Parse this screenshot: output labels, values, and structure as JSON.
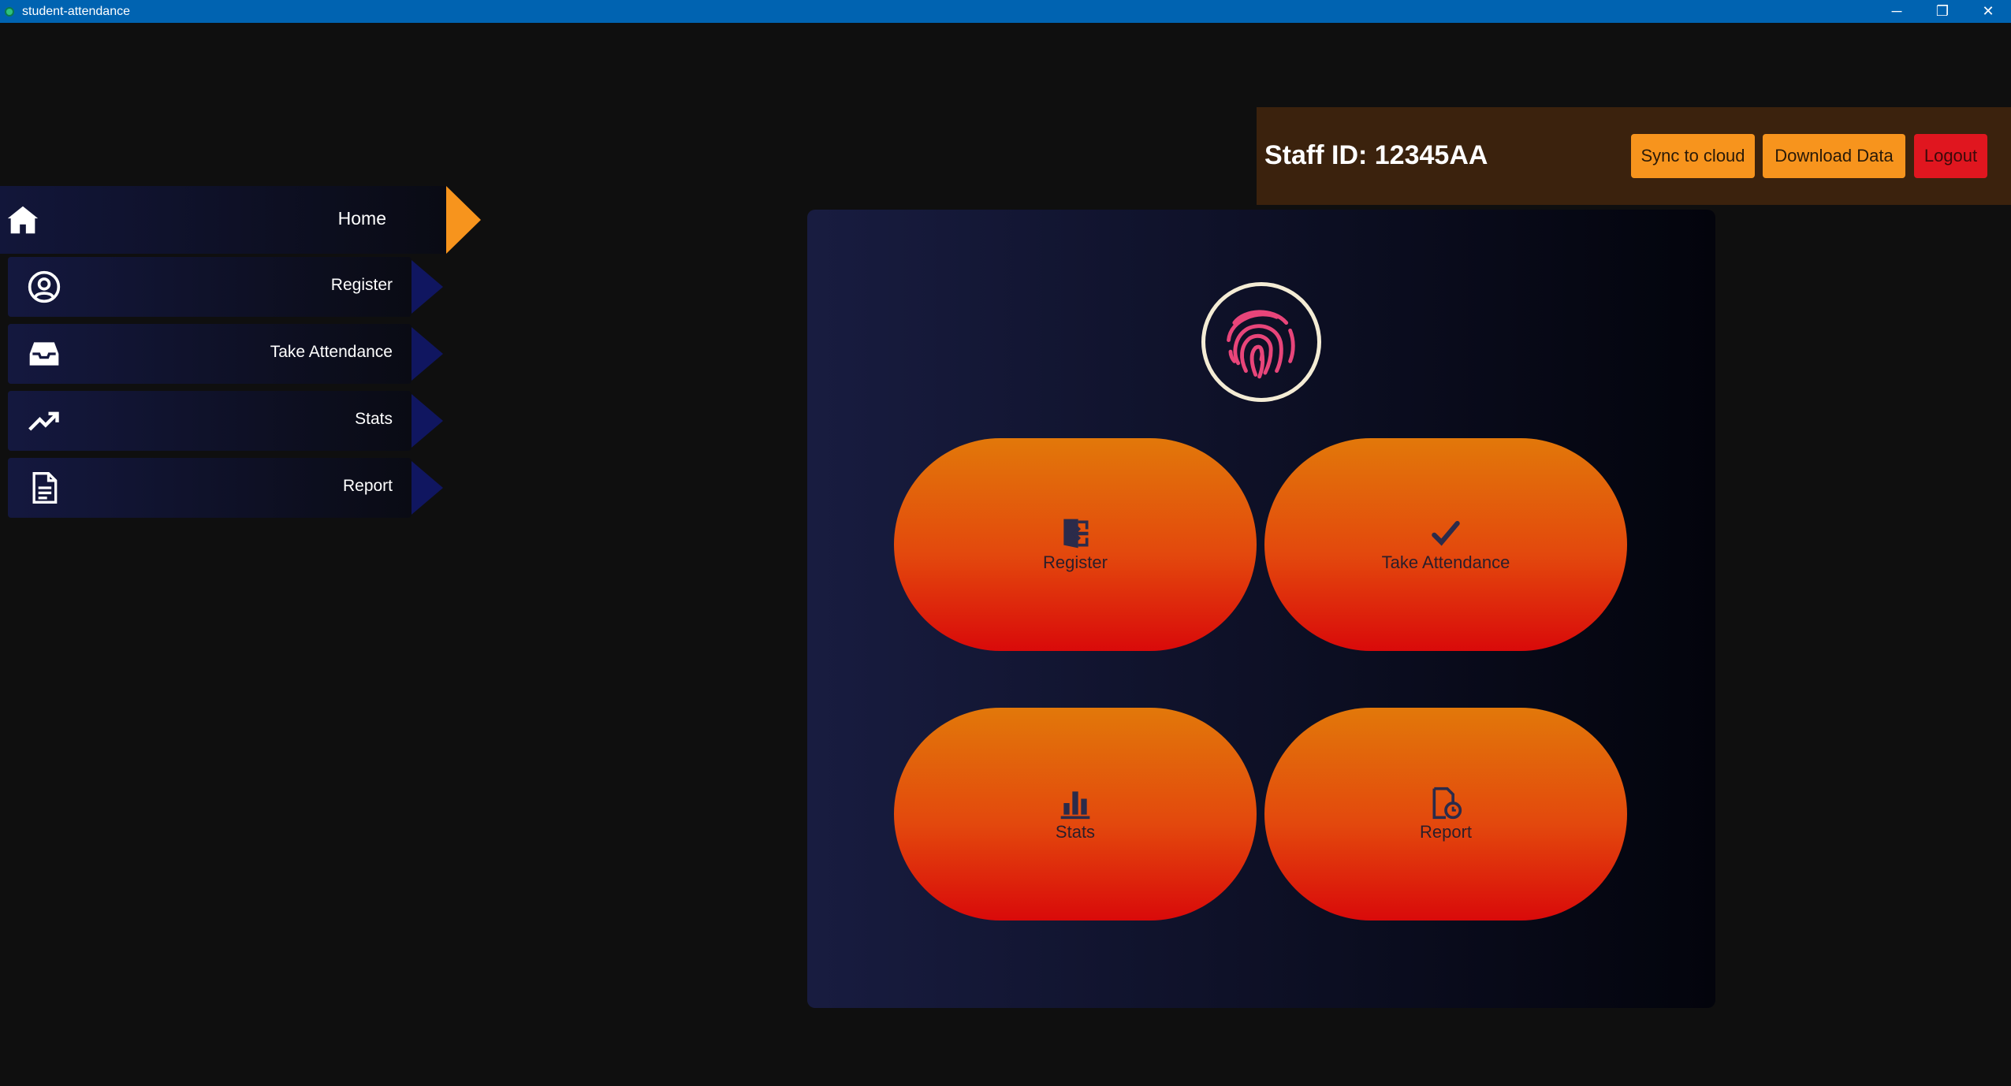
{
  "window": {
    "title": "student-attendance",
    "controls": {
      "minimize": "─",
      "restore": "❐",
      "close": "✕"
    }
  },
  "header": {
    "staff_id": "Staff ID: 12345AA",
    "buttons": {
      "sync": "Sync to cloud",
      "download": "Download Data",
      "logout": "Logout"
    }
  },
  "sidebar": {
    "items": [
      {
        "label": "Home",
        "icon": "home-icon",
        "active": true
      },
      {
        "label": "Register",
        "icon": "user-circle-icon"
      },
      {
        "label": "Take Attendance",
        "icon": "inbox-icon"
      },
      {
        "label": "Stats",
        "icon": "trending-up-icon"
      },
      {
        "label": "Report",
        "icon": "document-icon"
      }
    ]
  },
  "main": {
    "logo_icon": "fingerprint-icon",
    "actions": [
      {
        "label": "Register",
        "icon": "door-enter-icon"
      },
      {
        "label": "Take Attendance",
        "icon": "checkmark-icon"
      },
      {
        "label": "Stats",
        "icon": "bar-chart-icon"
      },
      {
        "label": "Report",
        "icon": "report-clock-icon"
      }
    ]
  },
  "colors": {
    "accent_orange": "#f7941d",
    "logout_red": "#e0161f",
    "titlebar_blue": "#0063b1",
    "nav_arrow": "#101660"
  }
}
